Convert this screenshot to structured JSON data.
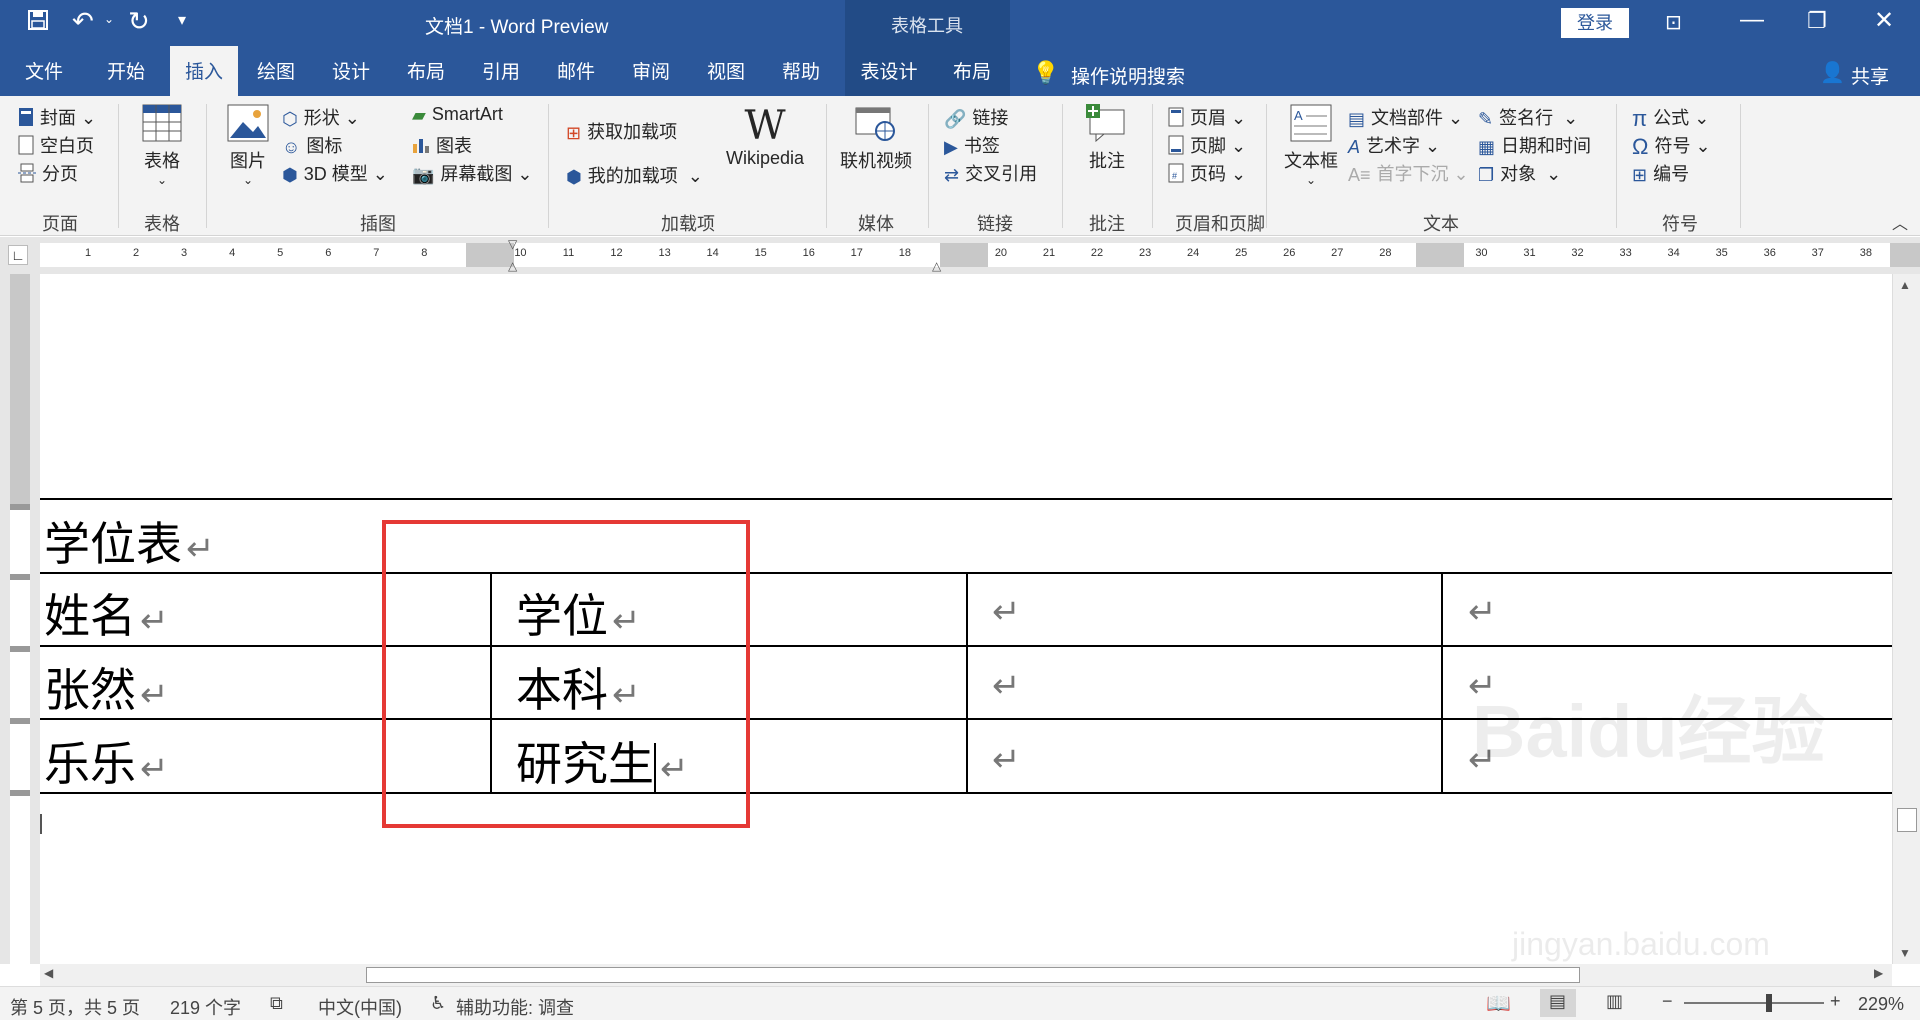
{
  "window": {
    "title": "文档1  -  Word Preview",
    "context_tool": "表格工具",
    "login_label": "登录"
  },
  "tabs": [
    "文件",
    "开始",
    "插入",
    "绘图",
    "设计",
    "布局",
    "引用",
    "邮件",
    "审阅",
    "视图",
    "帮助",
    "表设计",
    "布局"
  ],
  "search_label": "操作说明搜索",
  "share_label": "共享",
  "ribbon": {
    "page": {
      "items": [
        "封面",
        "空白页",
        "分页"
      ],
      "label": "页面"
    },
    "table": {
      "button": "表格",
      "label": "表格"
    },
    "illustrations": {
      "picture": "图片",
      "items": [
        "形状",
        "图标",
        "3D 模型",
        "SmartArt",
        "图表",
        "屏幕截图"
      ],
      "label": "插图"
    },
    "addins": {
      "get": "获取加载项",
      "mine": "我的加载项",
      "wikipedia": "Wikipedia",
      "label": "加载项"
    },
    "media": {
      "button": "联机视频",
      "label": "媒体"
    },
    "links": {
      "items": [
        "链接",
        "书签",
        "交叉引用"
      ],
      "label": "链接"
    },
    "comments": {
      "button": "批注",
      "label": "批注"
    },
    "header_footer": {
      "items": [
        "页眉",
        "页脚",
        "页码"
      ],
      "label": "页眉和页脚"
    },
    "text": {
      "textbox": "文本框",
      "items": [
        "文档部件",
        "艺术字",
        "首字下沉",
        "签名行",
        "日期和时间",
        "对象"
      ],
      "label": "文本"
    },
    "symbols": {
      "items": [
        "公式",
        "符号",
        "编号"
      ],
      "label": "符号"
    }
  },
  "ruler_numbers": [
    "1",
    "2",
    "3",
    "4",
    "5",
    "6",
    "7",
    "8",
    "10",
    "11",
    "12",
    "13",
    "14",
    "15",
    "16",
    "17",
    "18",
    "20",
    "21",
    "22",
    "23",
    "24",
    "25",
    "26",
    "27",
    "28",
    "30",
    "31",
    "32",
    "33",
    "34",
    "35",
    "36",
    "37",
    "38"
  ],
  "document": {
    "caption": "学位表",
    "rows": [
      [
        "姓名",
        "学位",
        "",
        ""
      ],
      [
        "张然",
        "本科",
        "",
        ""
      ],
      [
        "乐乐",
        "研究生",
        "",
        ""
      ]
    ]
  },
  "watermark": {
    "brand": "Baidu经验",
    "url": "jingyan.baidu.com"
  },
  "status": {
    "page": "第 5 页，共 5 页",
    "words": "219 个字",
    "language": "中文(中国)",
    "accessibility": "辅助功能: 调查",
    "zoom": "229%"
  },
  "colors": {
    "brand": "#2b579a",
    "highlight_box": "#e53935"
  }
}
